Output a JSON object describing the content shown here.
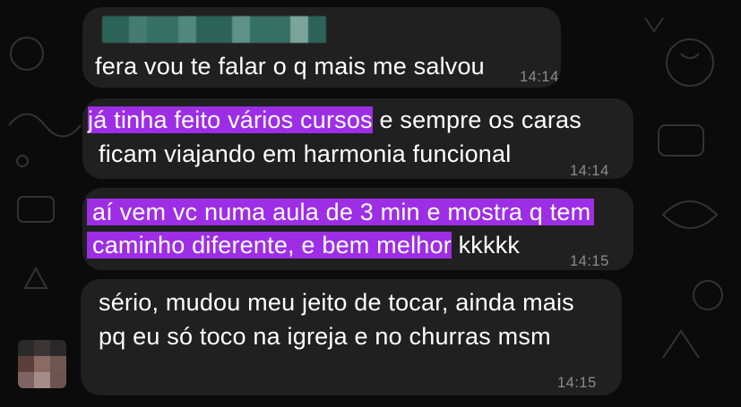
{
  "chat": {
    "messages": [
      {
        "id": "m1",
        "text": "fera vou te falar o q mais me salvou",
        "time": "14:14"
      },
      {
        "id": "m2",
        "lines": [
          {
            "highlight": "já tinha feito vários cursos",
            "rest": " e sempre os caras"
          },
          {
            "highlight": "",
            "rest": "ficam viajando em harmonia funcional"
          }
        ],
        "time": "14:14"
      },
      {
        "id": "m3",
        "lines": [
          {
            "highlight": "aí vem vc numa aula de 3 min e mostra q tem",
            "rest": ""
          },
          {
            "highlight": "caminho diferente, e bem melhor",
            "rest": " kkkkk"
          }
        ],
        "time": "14:15"
      },
      {
        "id": "m4",
        "lines": [
          "sério, mudou meu jeito de tocar, ainda mais",
          "pq eu só toco na igreja e no churras msm"
        ],
        "time": "14:15"
      }
    ]
  },
  "colors": {
    "background": "#0b0b0b",
    "bubble": "#202020",
    "highlight": "#9d2ee6",
    "timestamp": "#8c8c8c"
  },
  "icons": [
    "blurred-sender-name",
    "blurred-avatar",
    "wallpaper-doodles"
  ]
}
